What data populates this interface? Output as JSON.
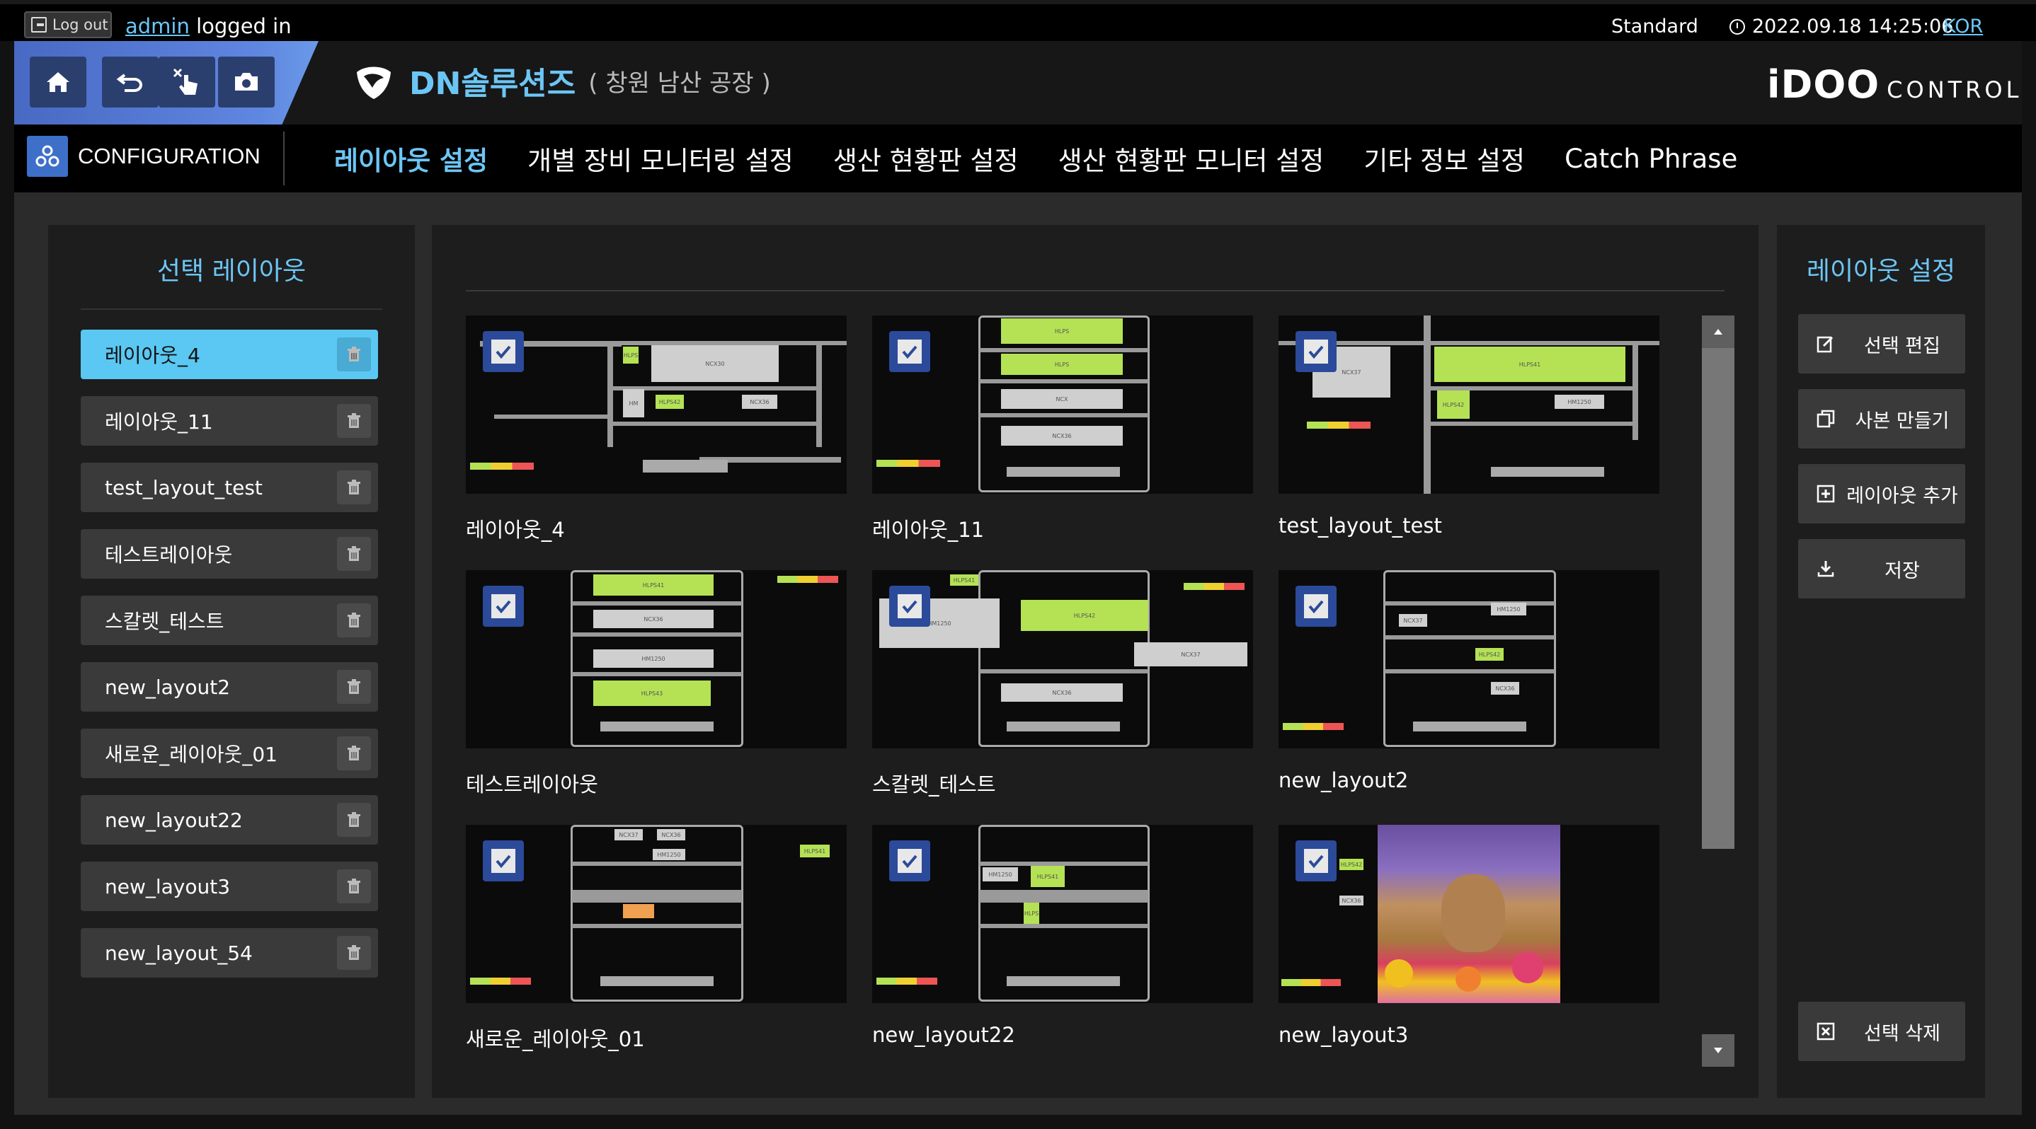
{
  "topbar": {
    "logout_label": "Log out",
    "user": "admin",
    "logged_in_text": " logged in",
    "mode": "Standard",
    "datetime": "2022.09.18 14:25:06",
    "language": "KOR"
  },
  "header": {
    "company_name": "DN솔루션즈",
    "site_name": "( 창원 남산 공장 )",
    "product_brand": "iDOO",
    "product_suffix": "CONTROL"
  },
  "nav": {
    "section_label": "CONFIGURATION",
    "tabs": [
      {
        "label": "레이아웃 설정",
        "active": true
      },
      {
        "label": "개별 장비 모니터링 설정",
        "active": false
      },
      {
        "label": "생산 현황판 설정",
        "active": false
      },
      {
        "label": "생산 현황판 모니터 설정",
        "active": false
      },
      {
        "label": "기타 정보 설정",
        "active": false
      },
      {
        "label": "Catch Phrase",
        "active": false
      }
    ]
  },
  "left_panel": {
    "title": "선택 레이아웃",
    "items": [
      {
        "label": "레이아웃_4",
        "selected": true
      },
      {
        "label": "레이아웃_11",
        "selected": false
      },
      {
        "label": "test_layout_test",
        "selected": false
      },
      {
        "label": "테스트레이아웃",
        "selected": false
      },
      {
        "label": "스칼렛_테스트",
        "selected": false
      },
      {
        "label": "new_layout2",
        "selected": false
      },
      {
        "label": "새로운_레이아웃_01",
        "selected": false
      },
      {
        "label": "new_layout22",
        "selected": false
      },
      {
        "label": "new_layout3",
        "selected": false
      },
      {
        "label": "new_layout_54",
        "selected": false
      }
    ]
  },
  "grid": {
    "cards": [
      {
        "caption": "레이아웃_4",
        "checked": true
      },
      {
        "caption": "레이아웃_11",
        "checked": true
      },
      {
        "caption": "test_layout_test",
        "checked": true
      },
      {
        "caption": "테스트레이아웃",
        "checked": true
      },
      {
        "caption": "스칼렛_테스트",
        "checked": true
      },
      {
        "caption": "new_layout2",
        "checked": true
      },
      {
        "caption": "새로운_레이아웃_01",
        "checked": true
      },
      {
        "caption": "new_layout22",
        "checked": true
      },
      {
        "caption": "new_layout3",
        "checked": true
      }
    ]
  },
  "right_panel": {
    "title": "레이아웃 설정",
    "buttons": {
      "edit": "선택 편집",
      "copy": "사본 만들기",
      "add": "레이아웃 추가",
      "save": "저장",
      "delete": "선택 삭제"
    }
  },
  "colors": {
    "accent": "#6cc6f5",
    "selected_item": "#5ac8f2",
    "checkbox": "#2c4a9a",
    "machine_green": "#b4e254"
  },
  "icons": {
    "home": "home-icon",
    "back": "undo-icon",
    "touch": "touch-pointer-icon",
    "camera": "camera-icon",
    "delete": "trash-icon"
  }
}
